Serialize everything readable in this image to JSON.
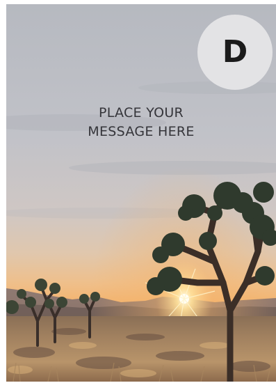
{
  "badge": {
    "letter": "D"
  },
  "message": {
    "line1": "PLACE YOUR",
    "line2": "MESSAGE HERE"
  },
  "colors": {
    "sky_top": "#b9bcc2",
    "sky_mid": "#c8c3c0",
    "sunset_glow": "#f2b06a",
    "ground": "#6b5240",
    "badge_bg": "#e3e3e5",
    "text": "#35353a"
  },
  "icons": {
    "badge": "letter-badge-icon",
    "scene": "desert-sunset-photo"
  }
}
